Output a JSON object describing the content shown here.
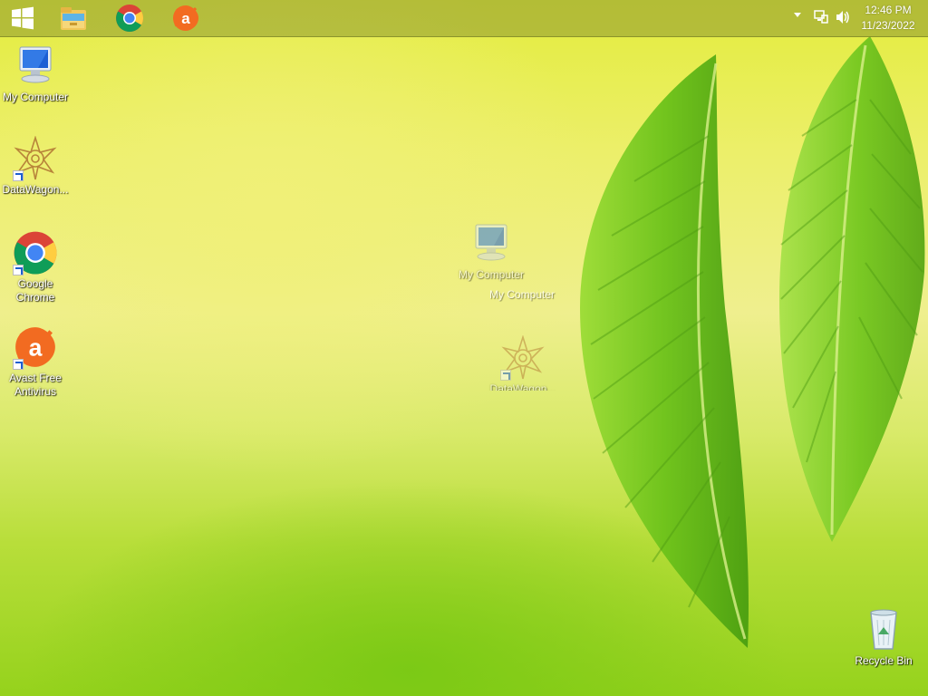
{
  "taskbar": {
    "pinned": [
      {
        "name": "start-button",
        "icon": "windows-logo-icon"
      },
      {
        "name": "file-explorer",
        "icon": "file-explorer-icon"
      },
      {
        "name": "google-chrome",
        "icon": "chrome-icon"
      },
      {
        "name": "avast",
        "icon": "avast-icon"
      }
    ],
    "tray": {
      "overflow_icon": "chevron-up-icon",
      "network_icon": "network-icon",
      "volume_icon": "volume-icon"
    },
    "clock": {
      "time": "12:46 PM",
      "date": "11/23/2022"
    }
  },
  "desktop": {
    "icons": [
      {
        "label": "My Computer",
        "icon": "computer-icon"
      },
      {
        "label": "DataWagon...",
        "icon": "datawagon-icon",
        "shortcut": true
      },
      {
        "label": "Google Chrome",
        "icon": "chrome-icon",
        "shortcut": true
      },
      {
        "label": "Avast Free Antivirus",
        "icon": "avast-icon",
        "shortcut": true
      },
      {
        "label": "Recycle Bin",
        "icon": "recycle-bin-icon"
      }
    ],
    "dragged": {
      "computer_label": "My Computer",
      "computer_label_copy": "My Computer",
      "datawagon_label": "DataWagon..."
    }
  },
  "colors": {
    "wallpaper_top": "#e3ec3d",
    "wallpaper_bottom": "#95d21c",
    "taskbar": "#96a032",
    "leaf": "#6ec31a"
  }
}
